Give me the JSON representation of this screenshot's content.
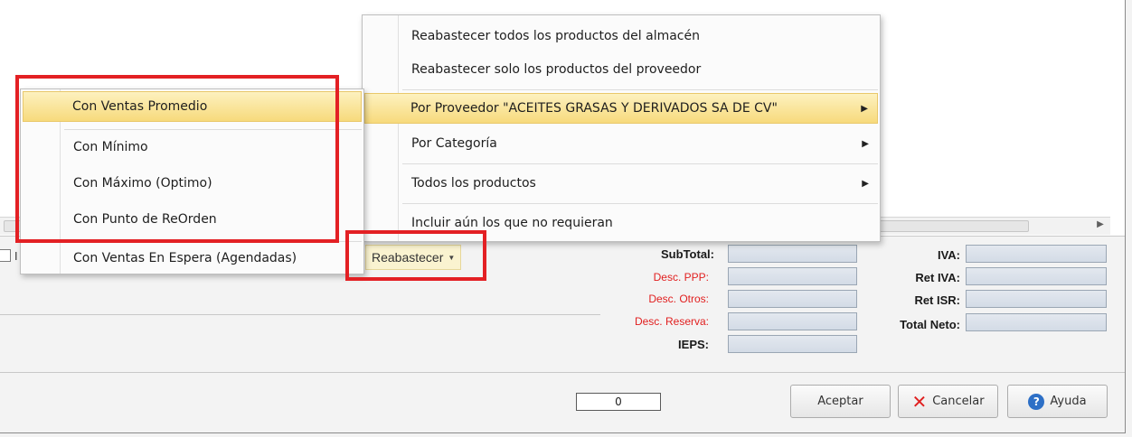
{
  "scroll": {
    "right_arrow": "▶"
  },
  "toolbar": {
    "checkbox_label": "I",
    "reabastecer_label": "Reabastecer",
    "reabastecer_caret": "▼"
  },
  "totals_left": {
    "subtotal": "SubTotal:",
    "desc_ppp": "Desc. PPP:",
    "desc_otros": "Desc. Otros:",
    "desc_reserva": "Desc. Reserva:",
    "ieps": "IEPS:"
  },
  "totals_right": {
    "iva": "IVA:",
    "ret_iva": "Ret IVA:",
    "ret_isr": "Ret ISR:",
    "total_neto": "Total Neto:"
  },
  "footer": {
    "counter_value": "0",
    "aceptar": "Aceptar",
    "cancelar": "Cancelar",
    "ayuda": "Ayuda",
    "help_glyph": "?",
    "cancel_glyph": "✕"
  },
  "main_menu": {
    "items": [
      {
        "label": "Reabastecer todos los productos del almacén",
        "submenu": false
      },
      {
        "label": "Reabastecer solo los productos del proveedor",
        "submenu": false
      },
      {
        "label": "Por Proveedor \"ACEITES GRASAS Y DERIVADOS SA DE CV\"",
        "submenu": true,
        "highlighted": true
      },
      {
        "label": "Por Categoría",
        "submenu": true
      },
      {
        "label": "Todos los productos",
        "submenu": true
      },
      {
        "label": "Incluir aún los que no requieran",
        "submenu": false
      }
    ],
    "arrow_glyph": "▶"
  },
  "sub_menu": {
    "items": [
      {
        "label": "Con Ventas Promedio",
        "highlighted": true
      },
      {
        "label": "Con Mínimo"
      },
      {
        "label": "Con Máximo (Optimo)"
      },
      {
        "label": "Con Punto de ReOrden"
      },
      {
        "label": "Con Ventas En Espera (Agendadas)"
      }
    ]
  },
  "colors": {
    "highlight_red": "#e32024",
    "menu_highlight": "#f7da7c",
    "red_label": "#e12020"
  }
}
